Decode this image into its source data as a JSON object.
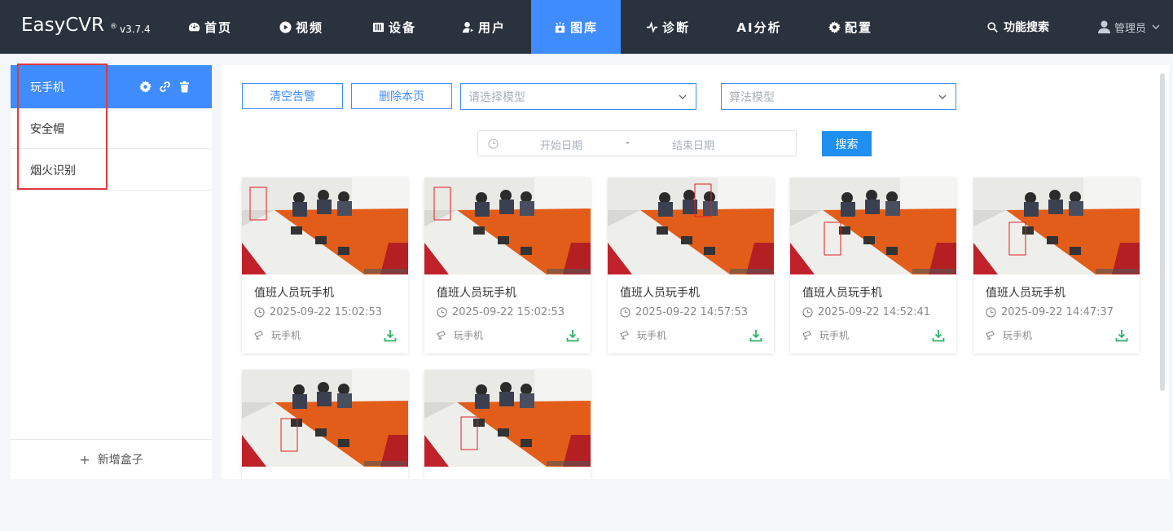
{
  "app": {
    "name": "EasyCVR",
    "version_mark": "®",
    "version": "v3.7.4"
  },
  "nav": {
    "items": [
      {
        "label": "首页",
        "icon": "dashboard-icon"
      },
      {
        "label": "视频",
        "icon": "play-circle-icon"
      },
      {
        "label": "设备",
        "icon": "device-icon"
      },
      {
        "label": "用户",
        "icon": "user-icon"
      },
      {
        "label": "图库",
        "icon": "gallery-icon",
        "active": true
      },
      {
        "label": "诊断",
        "icon": "pulse-icon"
      },
      {
        "label": "AI分析",
        "icon": ""
      },
      {
        "label": "配置",
        "icon": "gear-icon"
      }
    ],
    "search_label": "功能搜索",
    "user_label": "管理员"
  },
  "sidebar": {
    "items": [
      {
        "label": "玩手机",
        "active": true
      },
      {
        "label": "安全帽"
      },
      {
        "label": "烟火识别"
      }
    ],
    "add_label": "新增盒子"
  },
  "toolbar": {
    "clear_label": "清空告警",
    "delete_label": "删除本页",
    "model_placeholder": "请选择模型",
    "algo_placeholder": "算法模型",
    "start_placeholder": "开始日期",
    "range_sep": "-",
    "end_placeholder": "结束日期",
    "search_label": "搜索"
  },
  "cards": [
    {
      "title": "值班人员玩手机",
      "time": "2025-09-22 15:02:53",
      "tag": "玩手机"
    },
    {
      "title": "值班人员玩手机",
      "time": "2025-09-22 15:02:53",
      "tag": "玩手机"
    },
    {
      "title": "值班人员玩手机",
      "time": "2025-09-22 14:57:53",
      "tag": "玩手机"
    },
    {
      "title": "值班人员玩手机",
      "time": "2025-09-22 14:52:41",
      "tag": "玩手机"
    },
    {
      "title": "值班人员玩手机",
      "time": "2025-09-22 14:47:37",
      "tag": "玩手机"
    },
    {
      "title": "",
      "time": "",
      "tag": ""
    },
    {
      "title": "",
      "time": "",
      "tag": ""
    }
  ],
  "colors": {
    "nav_bg": "#2a323e",
    "accent": "#3f8cff",
    "highlight": "#e23a3a",
    "download": "#2fb36a"
  }
}
